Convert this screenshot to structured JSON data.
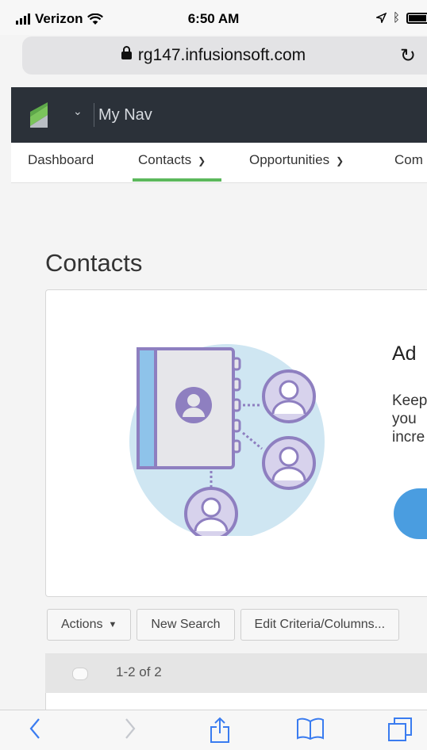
{
  "status_bar": {
    "carrier": "Verizon",
    "time": "6:50 AM"
  },
  "browser": {
    "url": "rg147.infusionsoft.com"
  },
  "app_header": {
    "title": "My Nav"
  },
  "nav": {
    "tabs": [
      {
        "label": "Dashboard"
      },
      {
        "label": "Contacts"
      },
      {
        "label": "Opportunities"
      },
      {
        "label": "Com"
      }
    ]
  },
  "page": {
    "title": "Contacts"
  },
  "empty_state": {
    "heading": "Ad",
    "blurb_lines": [
      "Keep",
      "you",
      "incre"
    ]
  },
  "toolbar": {
    "actions_label": "Actions",
    "new_search_label": "New Search",
    "edit_criteria_label": "Edit Criteria/Columns..."
  },
  "list": {
    "count_label": "1-2 of 2"
  },
  "colors": {
    "app_header_bg": "#2b3139",
    "active_tab": "#5cb85c",
    "cta": "#4a9de0",
    "illustration_purple": "#8e7fc0"
  }
}
